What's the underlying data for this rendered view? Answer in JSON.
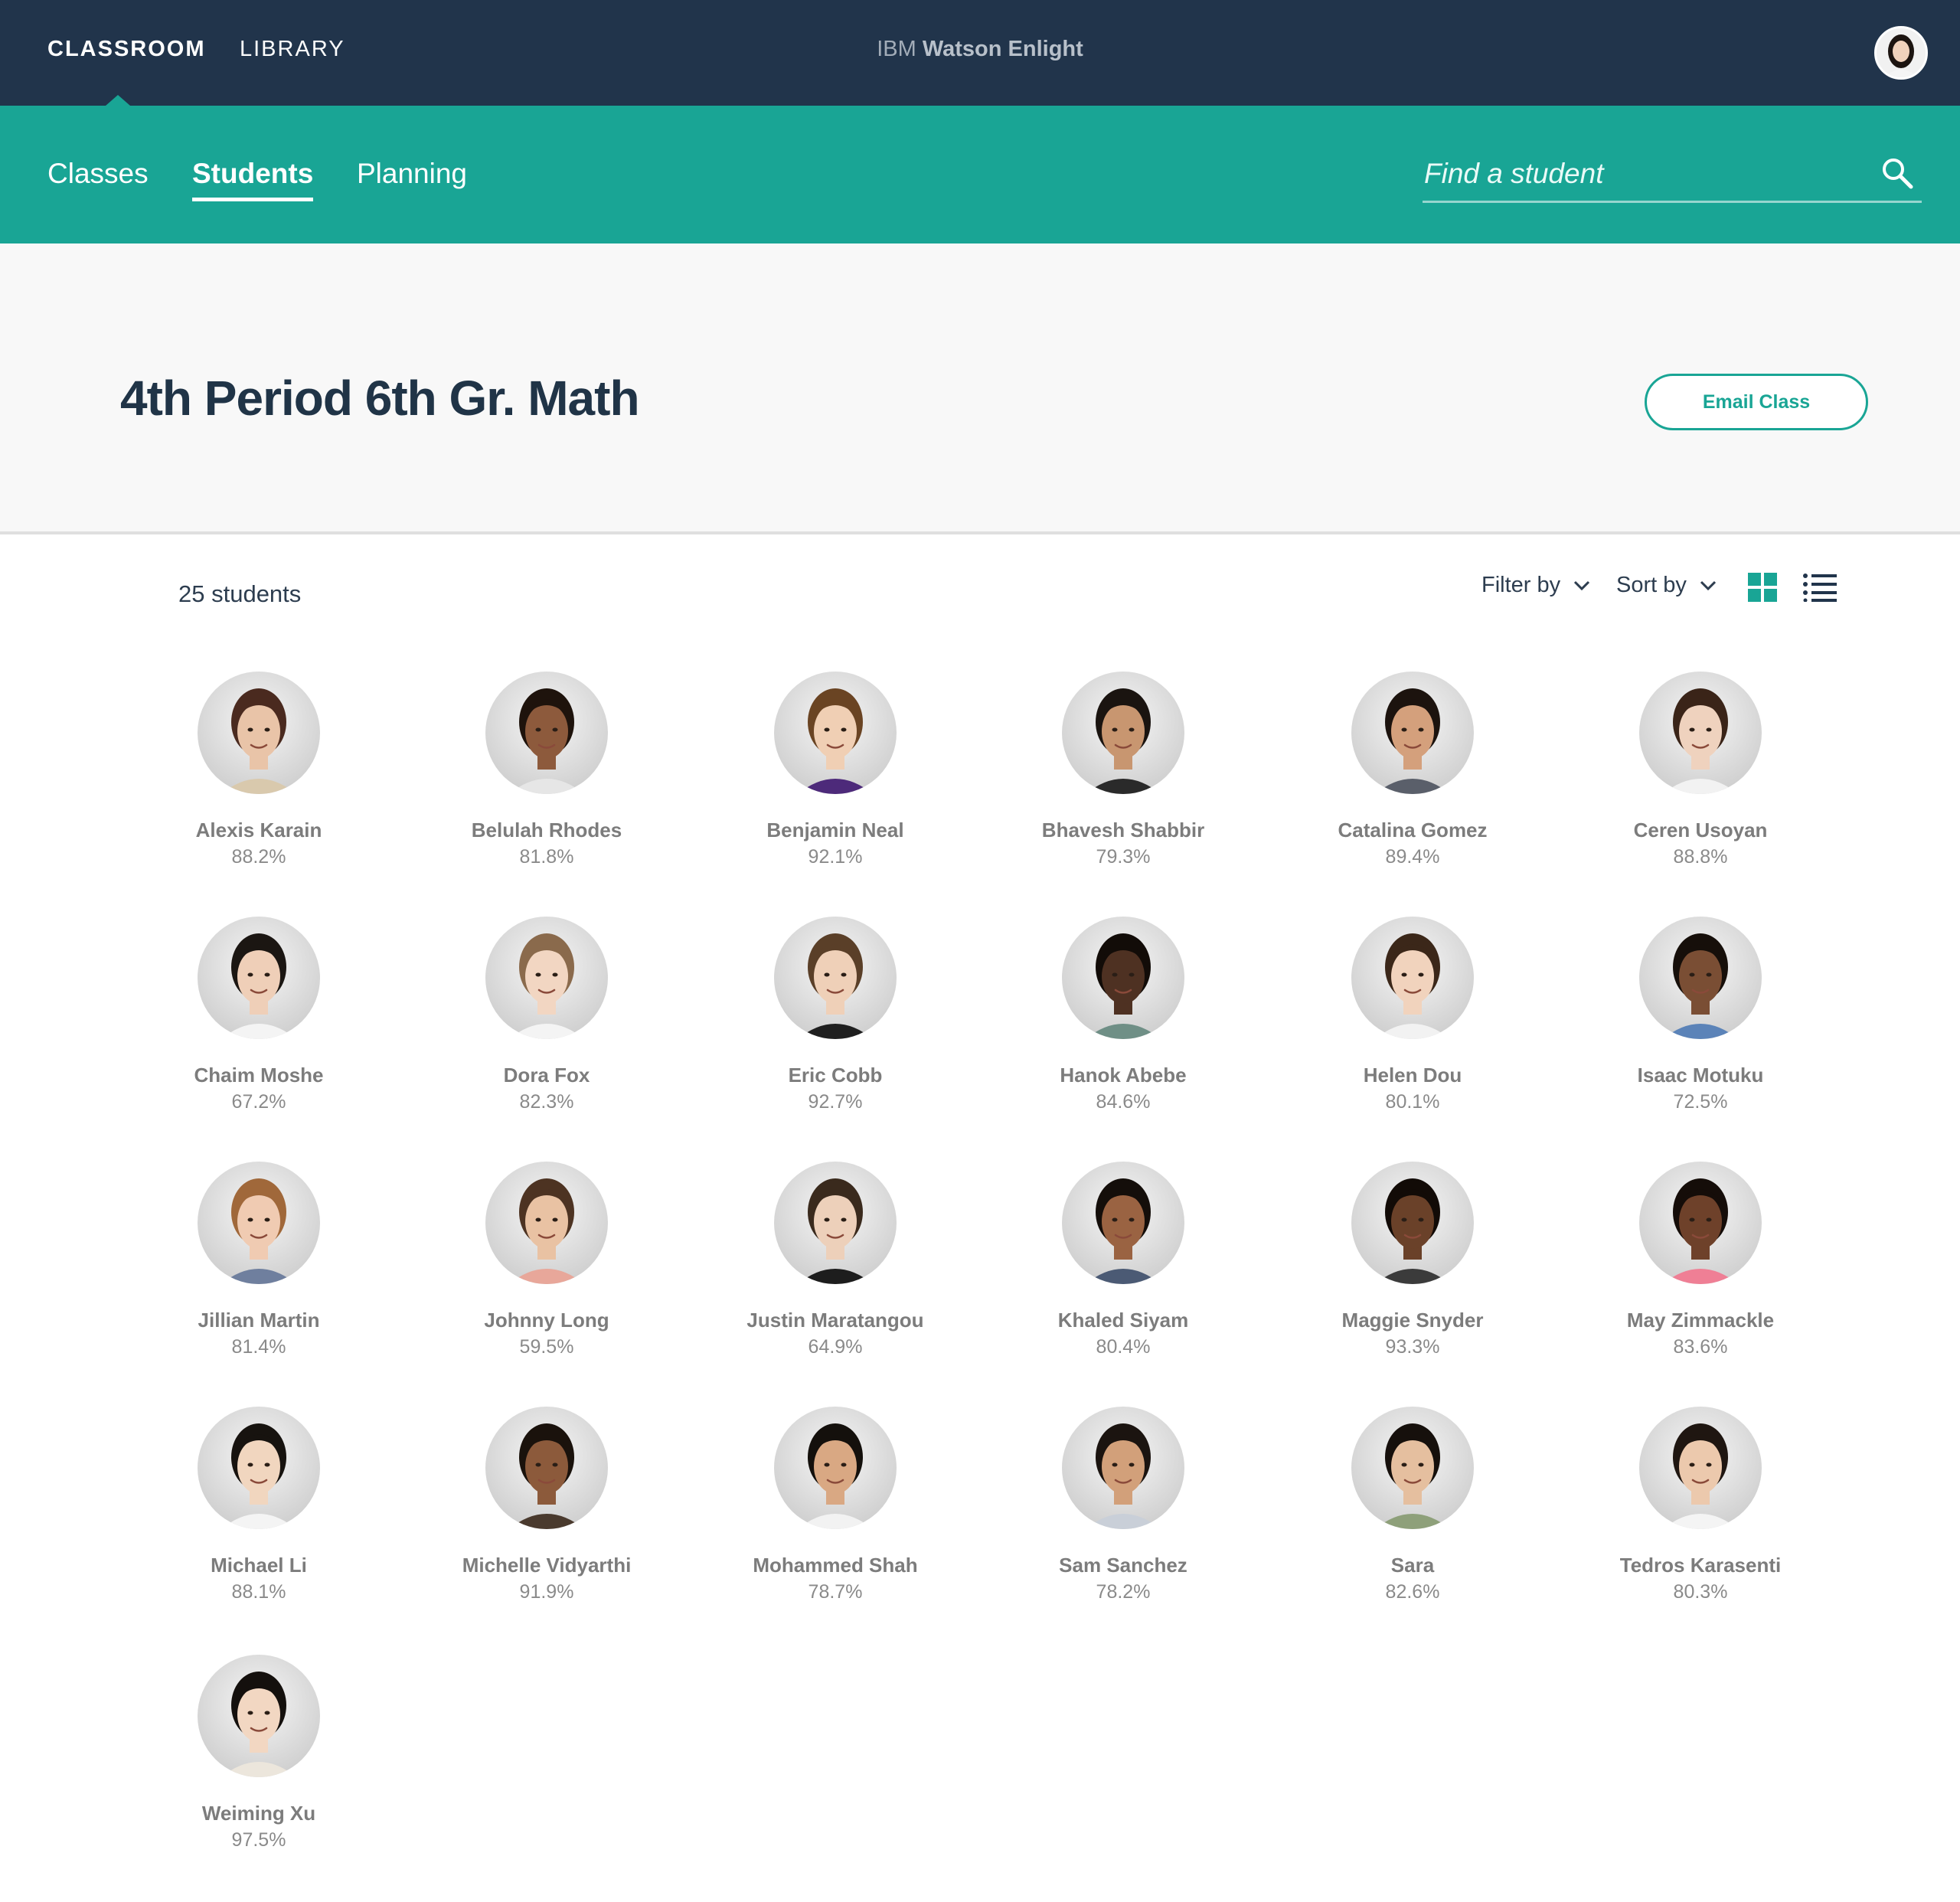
{
  "topbar": {
    "nav": [
      {
        "label": "CLASSROOM",
        "active": true
      },
      {
        "label": "LIBRARY",
        "active": false
      }
    ],
    "brand_prefix": "IBM",
    "brand_product": "Watson Enlight",
    "avatar_icon": "user-avatar"
  },
  "subnav": {
    "tabs": [
      {
        "label": "Classes",
        "active": false
      },
      {
        "label": "Students",
        "active": true
      },
      {
        "label": "Planning",
        "active": false
      }
    ],
    "search": {
      "placeholder": "Find a student",
      "value": "",
      "icon": "search-icon"
    }
  },
  "header": {
    "title": "4th Period 6th Gr. Math",
    "email_button": "Email Class"
  },
  "toolbar": {
    "count": "25 students",
    "filter_label": "Filter by",
    "sort_label": "Sort by",
    "view_mode": "grid"
  },
  "colors": {
    "navy": "#21344b",
    "teal": "#19a595",
    "title": "#203447",
    "name_gray": "#7c7c7c"
  },
  "students": [
    {
      "name": "Alexis Karain",
      "score": "88.2%",
      "skin": "#e9c4a8",
      "hair": "#4a2a1f",
      "shirt": "#d9c9ad"
    },
    {
      "name": "Belulah Rhodes",
      "score": "81.8%",
      "skin": "#8d5a3c",
      "hair": "#1e130c",
      "shirt": "#e6e6e6"
    },
    {
      "name": "Benjamin Neal",
      "score": "92.1%",
      "skin": "#f0cfb4",
      "hair": "#6a4423",
      "shirt": "#4d2a7a"
    },
    {
      "name": "Bhavesh Shabbir",
      "score": "79.3%",
      "skin": "#c89670",
      "hair": "#1a1410",
      "shirt": "#2a2a2a"
    },
    {
      "name": "Catalina Gomez",
      "score": "89.4%",
      "skin": "#d4a07c",
      "hair": "#1c130e",
      "shirt": "#5a5f6a"
    },
    {
      "name": "Ceren Usoyan",
      "score": "88.8%",
      "skin": "#efd2be",
      "hair": "#3a2418",
      "shirt": "#f2f2f2"
    },
    {
      "name": "Chaim Moshe",
      "score": "67.2%",
      "skin": "#efcfb8",
      "hair": "#1b1612",
      "shirt": "#f4f4f4"
    },
    {
      "name": "Dora Fox",
      "score": "82.3%",
      "skin": "#f2d6c2",
      "hair": "#8a6a4c",
      "shirt": "#f4f4f4"
    },
    {
      "name": "Eric Cobb",
      "score": "92.7%",
      "skin": "#efd0b8",
      "hair": "#5a3f28",
      "shirt": "#1f1f1f"
    },
    {
      "name": "Hanok Abebe",
      "score": "84.6%",
      "skin": "#4e3122",
      "hair": "#120c08",
      "shirt": "#6f8f86"
    },
    {
      "name": "Helen Dou",
      "score": "80.1%",
      "skin": "#f1d3bd",
      "hair": "#3b2719",
      "shirt": "#f2f2f2"
    },
    {
      "name": "Isaac Motuku",
      "score": "72.5%",
      "skin": "#7a4e34",
      "hair": "#160f0a",
      "shirt": "#5b83b8"
    },
    {
      "name": "Jillian Martin",
      "score": "81.4%",
      "skin": "#f0cbb2",
      "hair": "#a0683a",
      "shirt": "#6f7f9e"
    },
    {
      "name": "Johnny Long",
      "score": "59.5%",
      "skin": "#e9c2a3",
      "hair": "#4d3322",
      "shirt": "#e8a79a"
    },
    {
      "name": "Justin Maratangou",
      "score": "64.9%",
      "skin": "#edd0ba",
      "hair": "#3a2a1d",
      "shirt": "#1d1d1d"
    },
    {
      "name": "Khaled Siyam",
      "score": "80.4%",
      "skin": "#9a6342",
      "hair": "#140e0a",
      "shirt": "#4b5a74"
    },
    {
      "name": "Maggie Snyder",
      "score": "93.3%",
      "skin": "#6a4129",
      "hair": "#120b07",
      "shirt": "#3b3b3b"
    },
    {
      "name": "May Zimmackle",
      "score": "83.6%",
      "skin": "#6e412a",
      "hair": "#150d09",
      "shirt": "#ef7f95"
    },
    {
      "name": "Michael Li",
      "score": "88.1%",
      "skin": "#f1d6bf",
      "hair": "#17130f",
      "shirt": "#f4f4f4"
    },
    {
      "name": "Michelle Vidyarthi",
      "score": "91.9%",
      "skin": "#8c5a3b",
      "hair": "#1a120c",
      "shirt": "#4a3a2e"
    },
    {
      "name": "Mohammed Shah",
      "score": "78.7%",
      "skin": "#d9a883",
      "hair": "#14100c",
      "shirt": "#f2f2f2"
    },
    {
      "name": "Sam Sanchez",
      "score": "78.2%",
      "skin": "#d2a07a",
      "hair": "#1b1410",
      "shirt": "#c9cfd8"
    },
    {
      "name": "Sara",
      "score": "82.6%",
      "skin": "#e5bf9f",
      "hair": "#16100c",
      "shirt": "#8ea07a"
    },
    {
      "name": "Tedros Karasenti",
      "score": "80.3%",
      "skin": "#ecc9ad",
      "hair": "#1f1611",
      "shirt": "#f4f4f4"
    },
    {
      "name": "Weiming Xu",
      "score": "97.5%",
      "skin": "#f2d7c2",
      "hair": "#14100d",
      "shirt": "#ece6dc"
    }
  ]
}
